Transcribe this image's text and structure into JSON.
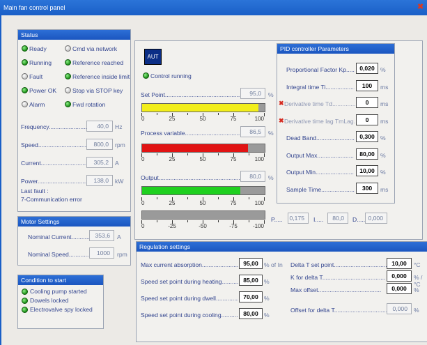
{
  "window": {
    "title": "Main fan control panel"
  },
  "status": {
    "title": "Status",
    "indicators": [
      {
        "label": "Ready",
        "state": "green"
      },
      {
        "label": "Cmd via network",
        "state": "off"
      },
      {
        "label": "Running",
        "state": "green"
      },
      {
        "label": "Reference reached",
        "state": "green"
      },
      {
        "label": "Fault",
        "state": "off"
      },
      {
        "label": "Reference inside limit",
        "state": "green"
      },
      {
        "label": "Power OK",
        "state": "green"
      },
      {
        "label": "Stop via STOP key",
        "state": "off"
      },
      {
        "label": "Alarm",
        "state": "off"
      },
      {
        "label": "Fwd rotation",
        "state": "green"
      }
    ],
    "values": [
      {
        "label": "Frequency.............................",
        "value": "40,0",
        "unit": "Hz"
      },
      {
        "label": "Speed...................................",
        "value": "800,0",
        "unit": "rpm"
      },
      {
        "label": "Current..................................",
        "value": "305,2",
        "unit": "A"
      },
      {
        "label": "Power....................................",
        "value": "138,0",
        "unit": "kW"
      }
    ],
    "last_fault_label": "Last fault :",
    "last_fault_value": "7-Communication error"
  },
  "motor": {
    "title": "Motor Settings",
    "current_label": "Nominal Current..............",
    "current_value": "353,6",
    "current_unit": "A",
    "speed_label": "Nominal Speed................",
    "speed_value": "1000",
    "speed_unit": "rpm"
  },
  "condition": {
    "title": "Condition to start",
    "items": [
      "Cooling pump started",
      "Dowels locked",
      "Electrovalve spy locked"
    ]
  },
  "control": {
    "aut_label": "AUT",
    "running_label": "Control running",
    "setpoint_label": "Set Point...................................................",
    "setpoint_value": "95,0",
    "setpoint_unit": "%",
    "pv_label": "Process variable.......................................",
    "pv_value": "86,5",
    "pv_unit": "%",
    "output_label": "Output..........................................................",
    "output_value": "80,0",
    "output_unit": "%",
    "scale_pos": [
      "0",
      "25",
      "50",
      "75",
      "100"
    ],
    "scale_neg": [
      "0",
      "-25",
      "-50",
      "-75",
      "-100"
    ],
    "bars": {
      "setpoint": 0.95,
      "pv": 0.865,
      "output": 0.8
    },
    "colors": {
      "setpoint": "#f2ee1a",
      "pv": "#e11313",
      "output": "#1fd01f"
    },
    "p_label": "P.....",
    "p_value": "0,175",
    "i_label": "I.....",
    "i_value": "80,0",
    "d_label": "D.....",
    "d_value": "0,000"
  },
  "pid": {
    "title": "PID controller Parameters",
    "rows": [
      {
        "label": "Proportional Factor Kp.........",
        "value": "0,020",
        "unit": "%",
        "error": false
      },
      {
        "label": "Integral time Ti.....................",
        "value": "100",
        "unit": "ms",
        "error": false
      },
      {
        "label": "Derivative time Td...............",
        "value": "0",
        "unit": "ms",
        "error": true
      },
      {
        "label": "Derivative time lag TmLag......",
        "value": "0",
        "unit": "ms",
        "error": true
      },
      {
        "label": "Dead Band..........................",
        "value": "0,300",
        "unit": "%",
        "error": false
      },
      {
        "label": "Output Max......................",
        "value": "80,00",
        "unit": "%",
        "error": false
      },
      {
        "label": "Output Min.......................",
        "value": "10,00",
        "unit": "%",
        "error": false
      },
      {
        "label": "Sample Time.....................",
        "value": "300",
        "unit": "ms",
        "error": false
      }
    ]
  },
  "regulation": {
    "title": "Regulation settings",
    "left": [
      {
        "label": "Max current absorption..................................",
        "value": "95,00",
        "unit": "% of In"
      },
      {
        "label": "Speed set point during heating................",
        "value": "85,00",
        "unit": "%"
      },
      {
        "label": "Speed set point during dwell..................",
        "value": "70,00",
        "unit": "%"
      },
      {
        "label": "Speed set point during cooling..................",
        "value": "80,00",
        "unit": "%"
      }
    ],
    "right": [
      {
        "label": "Delta T set point.....................................",
        "value": "10,00",
        "unit": "°C",
        "editable": true
      },
      {
        "label": "K for delta T......................................",
        "value": "0,000",
        "unit": "% / °C",
        "editable": true
      },
      {
        "label": "Max offset......................................",
        "value": "0,000",
        "unit": "%",
        "editable": true
      },
      {
        "label": "Offset for delta T.................................",
        "value": "0,000",
        "unit": "%",
        "editable": false
      }
    ]
  }
}
